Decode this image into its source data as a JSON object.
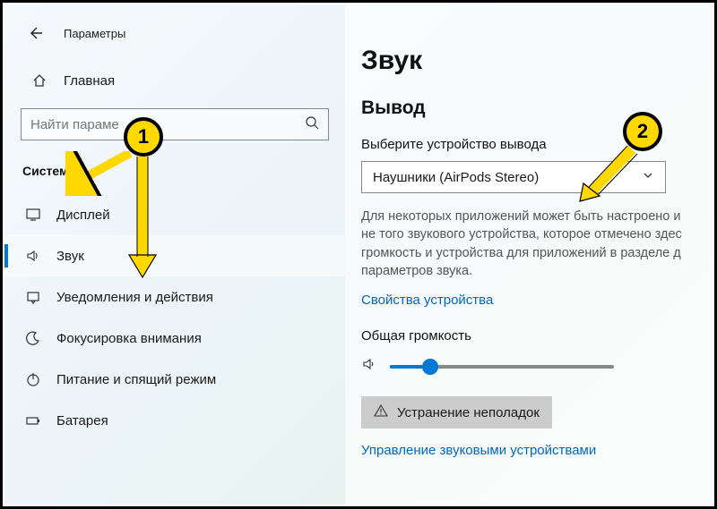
{
  "header": {
    "title": "Параметры"
  },
  "sidebar": {
    "home": "Главная",
    "searchPlaceholder": "Найти параме",
    "section": "Система",
    "items": [
      {
        "label": "Дисплей"
      },
      {
        "label": "Звук"
      },
      {
        "label": "Уведомления и действия"
      },
      {
        "label": "Фокусировка внимания"
      },
      {
        "label": "Питание и спящий режим"
      },
      {
        "label": "Батарея"
      }
    ]
  },
  "content": {
    "pageTitle": "Звук",
    "outputTitle": "Вывод",
    "outputLabel": "Выберите устройство вывода",
    "outputDevice": "Наушники (AirPods Stereo)",
    "desc1": "Для некоторых приложений может быть настроено и",
    "desc2": "не того звукового устройства, которое отмечено здес",
    "desc3": "громкость и устройства для приложений в разделе д",
    "desc4": "параметров звука.",
    "propsLink": "Свойства устройства",
    "volumeLabel": "Общая громкость",
    "troubleshoot": "Устранение неполадок",
    "manageLink": "Управление звуковыми устройствами"
  },
  "annotations": {
    "marker1": "1",
    "marker2": "2"
  }
}
